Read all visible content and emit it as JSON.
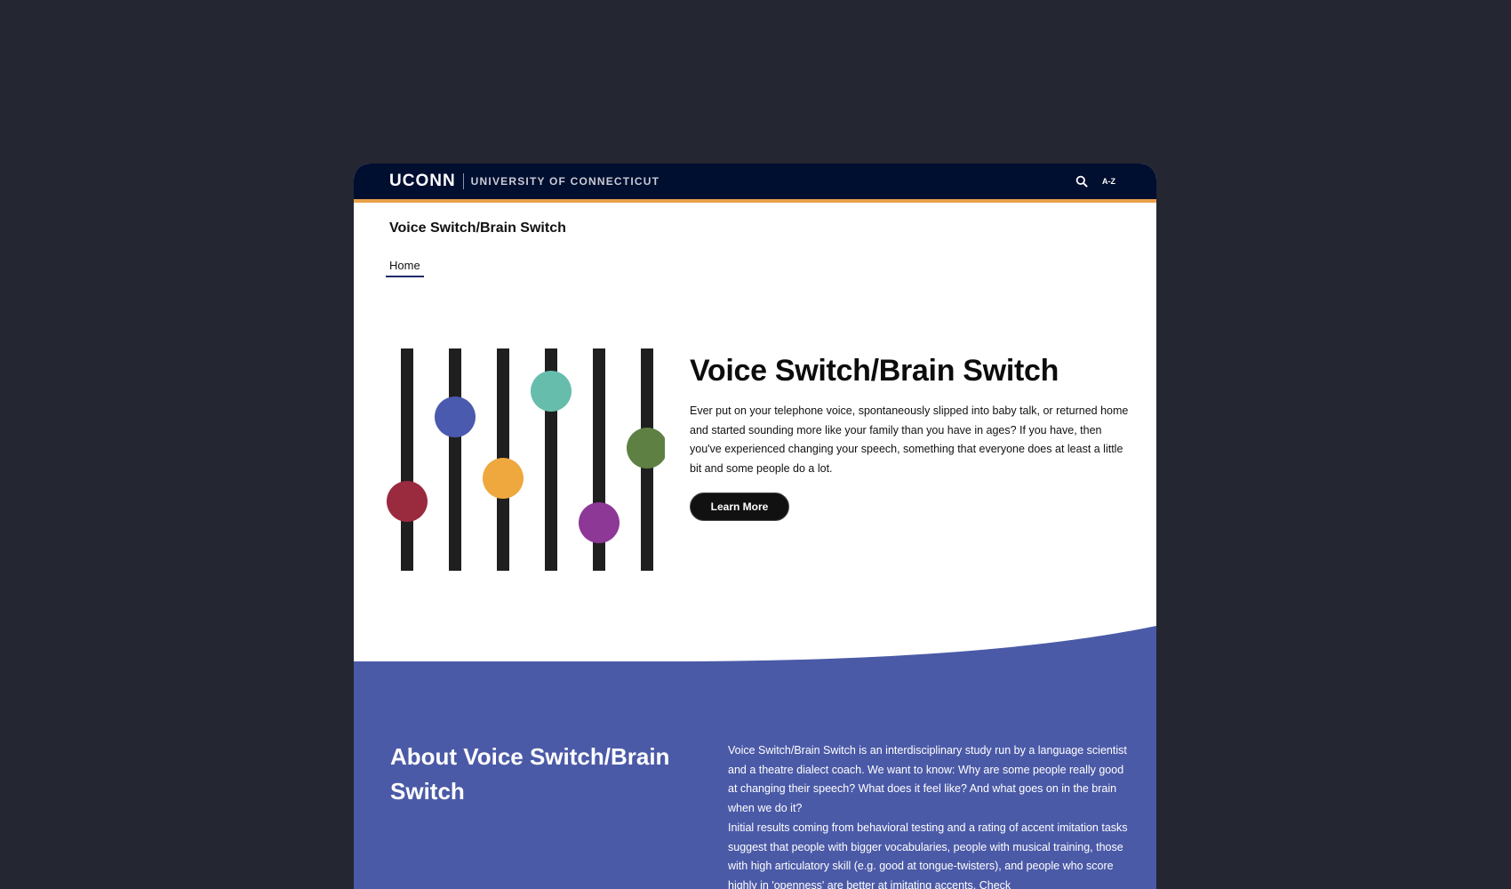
{
  "header": {
    "logo_mark": "UCONN",
    "logo_text": "UNIVERSITY OF CONNECTICUT",
    "az_label": "A-Z",
    "search_icon": "search-icon"
  },
  "site": {
    "title": "Voice Switch/Brain Switch"
  },
  "nav": {
    "items": [
      {
        "label": "Home"
      }
    ]
  },
  "hero": {
    "title": "Voice Switch/Brain Switch",
    "body": "Ever put on your telephone voice, spontaneously slipped into baby talk, or returned home and started sounding more like your family than you have in ages?  If you have, then you've experienced changing your speech, something that everyone does at least a little bit and some people do a lot.",
    "button_label": "Learn More",
    "slider_colors": [
      "#9a2a3e",
      "#4a5aae",
      "#eea83d",
      "#66bdac",
      "#8d3796",
      "#5f8043"
    ]
  },
  "about": {
    "title": "About Voice Switch/Brain Switch",
    "paragraph_1": "Voice Switch/Brain Switch is an interdisciplinary study run by a language scientist and a theatre dialect coach.  We want to know: Why are some people really good at changing their speech?  What does it feel like?  And what goes on in the brain when we do it?",
    "paragraph_2": "Initial results coming from behavioral testing and a rating of accent imitation tasks suggest that people with bigger vocabularies, people with musical training, those with high articulatory skill (e.g. good at tongue-twisters), and people who score highly in 'openness' are better at imitating accents.  Check",
    "background_color": "#4b5aa7"
  },
  "colors": {
    "page_background": "#242632",
    "topbar": "#000e2f",
    "topbar_accent": "#e9a24a"
  }
}
